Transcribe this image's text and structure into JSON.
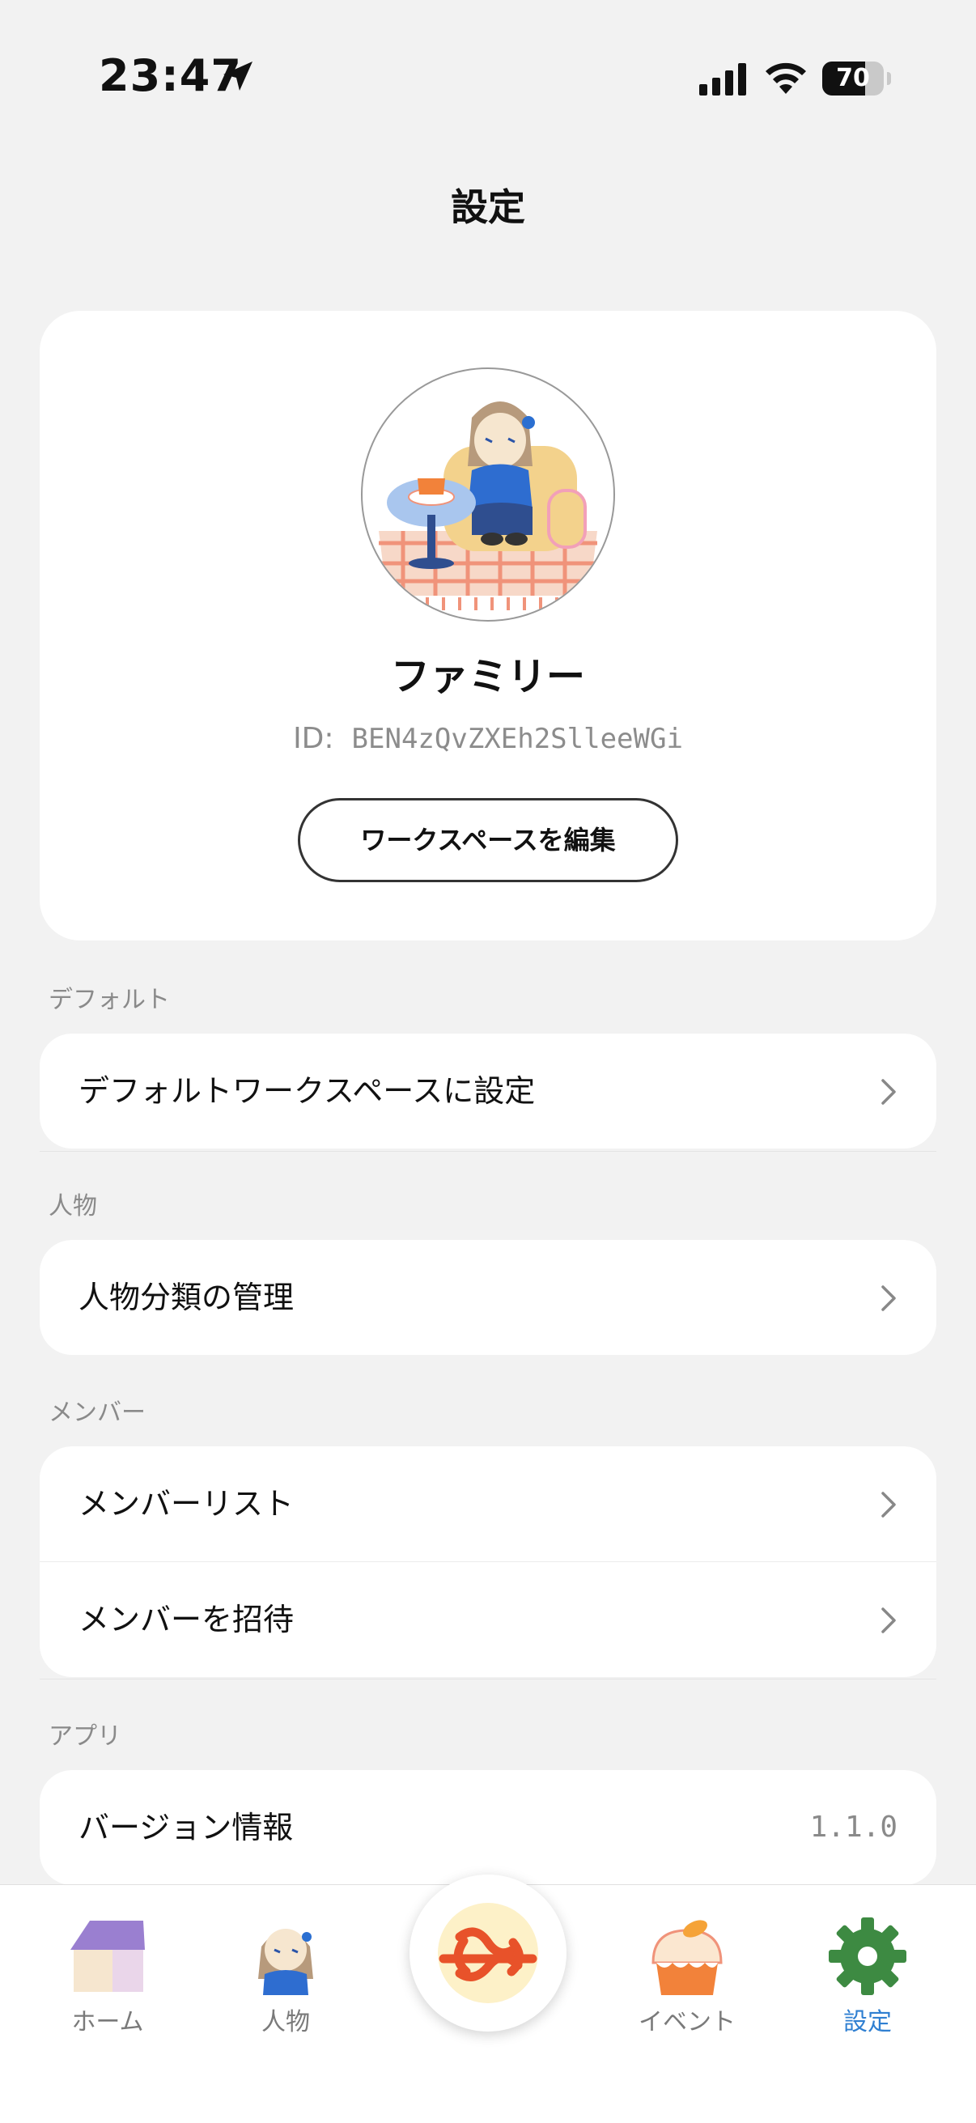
{
  "status_bar": {
    "time": "23:47",
    "battery": "70",
    "battery_level": 0.7
  },
  "header": {
    "title": "設定"
  },
  "profile": {
    "name": "ファミリー",
    "id_label": "ID:",
    "id_value": "BEN4zQvZXEh2SlleeWGi",
    "edit_button": "ワークスペースを編集"
  },
  "sections": {
    "default": {
      "title": "デフォルト",
      "items": [
        "デフォルトワークスペースに設定"
      ]
    },
    "person": {
      "title": "人物",
      "items": [
        "人物分類の管理"
      ]
    },
    "member": {
      "title": "メンバー",
      "items": [
        "メンバーリスト",
        "メンバーを招待"
      ]
    },
    "app": {
      "title": "アプリ",
      "items": [
        {
          "label": "バージョン情報",
          "value": "1.1.0"
        }
      ]
    }
  },
  "tab_bar": {
    "tabs": [
      {
        "label": "ホーム",
        "icon": "home-icon"
      },
      {
        "label": "人物",
        "icon": "person-icon"
      },
      {
        "label": "",
        "icon": "knot-icon"
      },
      {
        "label": "イベント",
        "icon": "cake-icon"
      },
      {
        "label": "設定",
        "icon": "gear-icon"
      }
    ],
    "active": "設定",
    "active_color": "#2f7fd1"
  }
}
